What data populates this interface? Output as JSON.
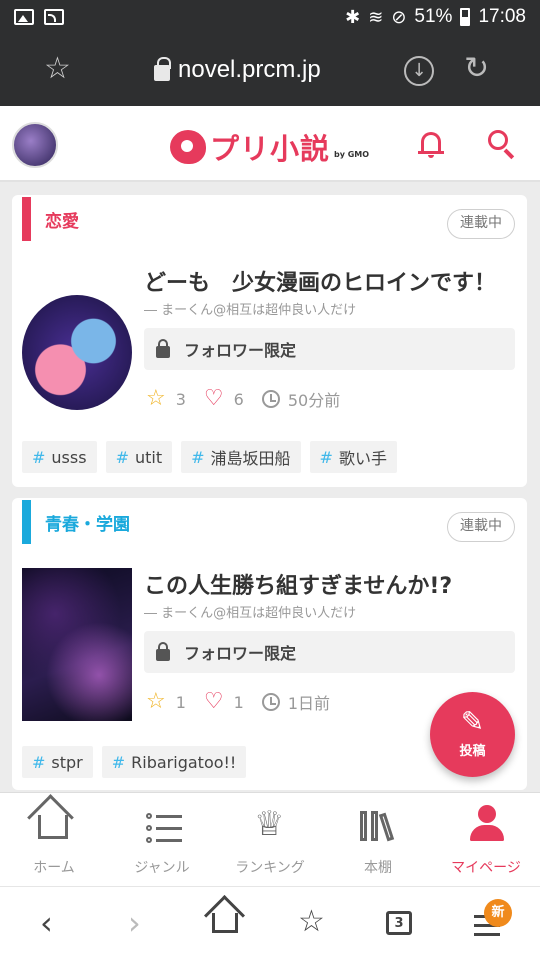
{
  "statusbar": {
    "battery": "51%",
    "time": "17:08"
  },
  "browser": {
    "url": "novel.prcm.jp"
  },
  "header": {
    "logo_text": "プリ小説",
    "logo_sub": "by GMO"
  },
  "stories": [
    {
      "genre": "恋愛",
      "genre_color": "#e63a5c",
      "status": "連載中",
      "title": "どーも　少女漫画のヒロインです！",
      "author": "― まーくん@相互は超仲良い人だけ",
      "restriction": "フォロワー限定",
      "stars": "3",
      "hearts": "6",
      "updated": "50分前",
      "tags": [
        "usss",
        "utit",
        "浦島坂田船",
        "歌い手"
      ]
    },
    {
      "genre": "青春・学園",
      "genre_color": "#1aa9dc",
      "status": "連載中",
      "title": "この人生勝ち組すぎませんか!?",
      "author": "― まーくん@相互は超仲良い人だけ",
      "restriction": "フォロワー限定",
      "stars": "1",
      "hearts": "1",
      "updated": "1日前",
      "tags": [
        "stpr",
        "Ribarigatoo!!"
      ]
    }
  ],
  "fab": {
    "label": "投稿"
  },
  "tabs": [
    "ホーム",
    "ジャンル",
    "ランキング",
    "本棚",
    "マイページ"
  ],
  "navbar": {
    "tab_count": "3",
    "badge": "新"
  },
  "colors": {
    "accent": "#e63a5c",
    "tag_hash": "#40b8ea",
    "star": "#f0b323"
  }
}
